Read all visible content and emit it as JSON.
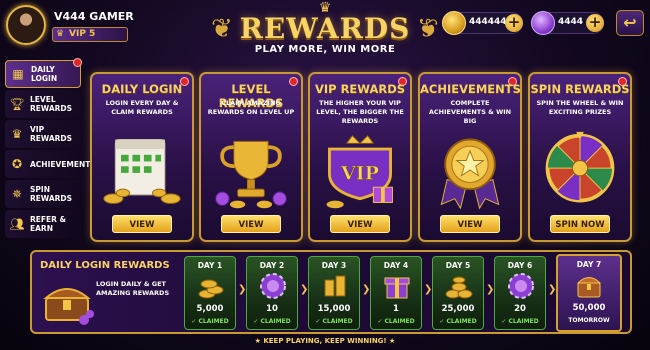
{
  "profile": {
    "username": "V444 GAMER",
    "vip_label": "VIP 5"
  },
  "header": {
    "title": "REWARDS",
    "subtitle": "PLAY MORE, WIN MORE"
  },
  "currency": {
    "coins": "444444",
    "gems": "4444"
  },
  "sidebar": {
    "items": [
      {
        "label": "DAILY LOGIN",
        "icon": "calendar-icon"
      },
      {
        "label": "LEVEL REWARDS",
        "icon": "trophy-icon"
      },
      {
        "label": "VIP REWARDS",
        "icon": "crown-icon"
      },
      {
        "label": "ACHIEVEMENTS",
        "icon": "medal-icon"
      },
      {
        "label": "SPIN REWARDS",
        "icon": "wheel-icon"
      },
      {
        "label": "REFER & EARN",
        "icon": "users-icon"
      }
    ]
  },
  "cards": [
    {
      "title": "DAILY LOGIN",
      "desc": "LOGIN EVERY DAY & CLAIM REWARDS",
      "button": "VIEW"
    },
    {
      "title": "LEVEL REWARDS",
      "desc": "CLAIM AMAZING REWARDS ON LEVEL UP",
      "button": "VIEW"
    },
    {
      "title": "VIP REWARDS",
      "desc": "THE HIGHER YOUR VIP LEVEL, THE BIGGER THE REWARDS",
      "button": "VIEW",
      "badge": "VIP"
    },
    {
      "title": "ACHIEVEMENTS",
      "desc": "COMPLETE ACHIEVEMENTS & WIN BIG",
      "button": "VIEW"
    },
    {
      "title": "SPIN REWARDS",
      "desc": "SPIN THE WHEEL & WIN EXCITING PRIZES",
      "button": "SPIN NOW"
    }
  ],
  "daily_login": {
    "title": "DAILY LOGIN REWARDS",
    "desc": "LOGIN DAILY & GET AMAZING REWARDS",
    "days": [
      {
        "label": "DAY 1",
        "amount": "5,000",
        "status": "✓ CLAIMED",
        "reward": "coins"
      },
      {
        "label": "DAY 2",
        "amount": "10",
        "status": "✓ CLAIMED",
        "reward": "chip"
      },
      {
        "label": "DAY 3",
        "amount": "15,000",
        "status": "✓ CLAIMED",
        "reward": "coins"
      },
      {
        "label": "DAY 4",
        "amount": "1",
        "status": "✓ CLAIMED",
        "reward": "gift"
      },
      {
        "label": "DAY 5",
        "amount": "25,000",
        "status": "✓ CLAIMED",
        "reward": "coins"
      },
      {
        "label": "DAY 6",
        "amount": "20",
        "status": "✓ CLAIMED",
        "reward": "chip"
      },
      {
        "label": "DAY 7",
        "amount": "50,000",
        "status": "TOMORROW",
        "reward": "chest"
      }
    ]
  },
  "footer": "★ KEEP PLAYING, KEEP WINNING! ★"
}
